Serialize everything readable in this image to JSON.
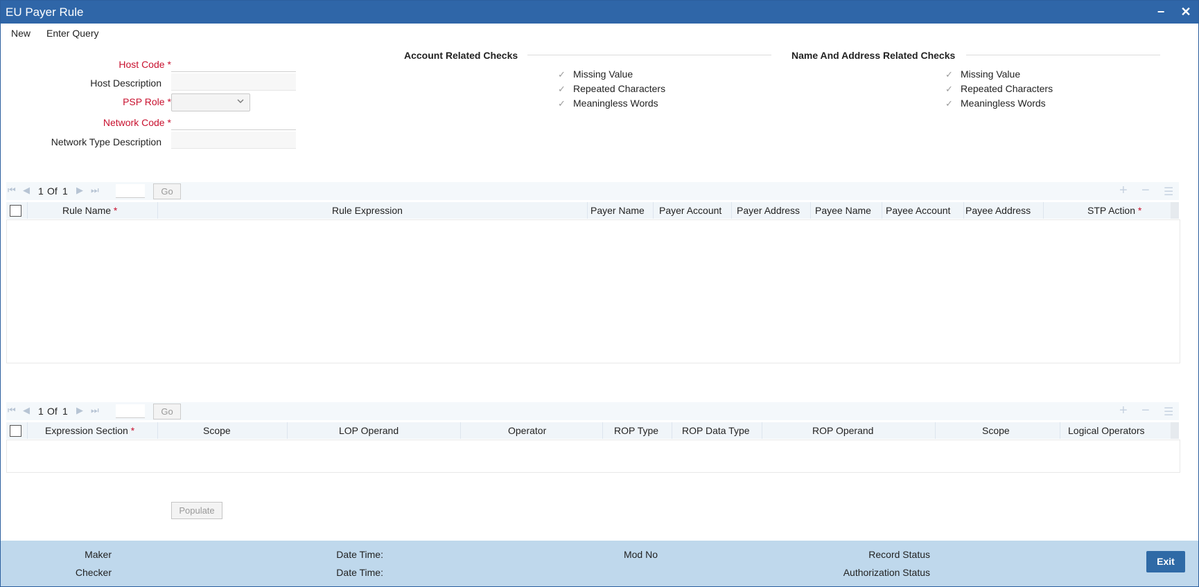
{
  "window": {
    "title": "EU Payer Rule",
    "minimize_glyph": "−",
    "close_glyph": "✕"
  },
  "menu": {
    "new": "New",
    "enter_query": "Enter Query"
  },
  "form": {
    "host_code": {
      "label": "Host Code",
      "value": ""
    },
    "host_description": {
      "label": "Host Description",
      "value": ""
    },
    "psp_role": {
      "label": "PSP Role",
      "value": ""
    },
    "network_code": {
      "label": "Network Code",
      "value": ""
    },
    "network_type_description": {
      "label": "Network Type Description",
      "value": ""
    },
    "required_mark": "*"
  },
  "account_checks": {
    "title": "Account Related Checks",
    "items": [
      "Missing Value",
      "Repeated Characters",
      "Meaningless Words"
    ]
  },
  "name_address_checks": {
    "title": "Name And Address Related Checks",
    "items": [
      "Missing Value",
      "Repeated Characters",
      "Meaningless Words"
    ]
  },
  "rules_grid": {
    "pager": {
      "current": "1",
      "of_label": "Of",
      "total": "1",
      "go_label": "Go"
    },
    "columns": [
      "Rule Name",
      "Rule Expression",
      "Payer Name",
      "Payer Account",
      "Payer Address",
      "Payee Name",
      "Payee Account",
      "Payee Address",
      "STP Action"
    ],
    "rows": []
  },
  "expression_grid": {
    "pager": {
      "current": "1",
      "of_label": "Of",
      "total": "1",
      "go_label": "Go"
    },
    "columns": [
      "Expression Section",
      "Scope",
      "LOP Operand",
      "Operator",
      "ROP Type",
      "ROP Data Type",
      "ROP Operand",
      "Scope",
      "Logical Operators"
    ],
    "rows": []
  },
  "populate_label": "Populate",
  "footer": {
    "maker": "Maker",
    "checker": "Checker",
    "date_time_1": "Date Time:",
    "date_time_2": "Date Time:",
    "mod_no": "Mod No",
    "record_status": "Record Status",
    "authorization_status": "Authorization Status"
  },
  "exit_label": "Exit",
  "icons": {
    "check": "checkmark-icon",
    "first": "first-page-icon",
    "prev": "prev-page-icon",
    "next": "next-page-icon",
    "last": "last-page-icon",
    "add": "add-row-icon",
    "remove": "remove-row-icon",
    "list": "list-view-icon"
  },
  "colors": {
    "title_bar": "#2f66a8",
    "footer": "#bfd8ec",
    "required": "#c8102e",
    "exit_button": "#2f6aa6"
  }
}
